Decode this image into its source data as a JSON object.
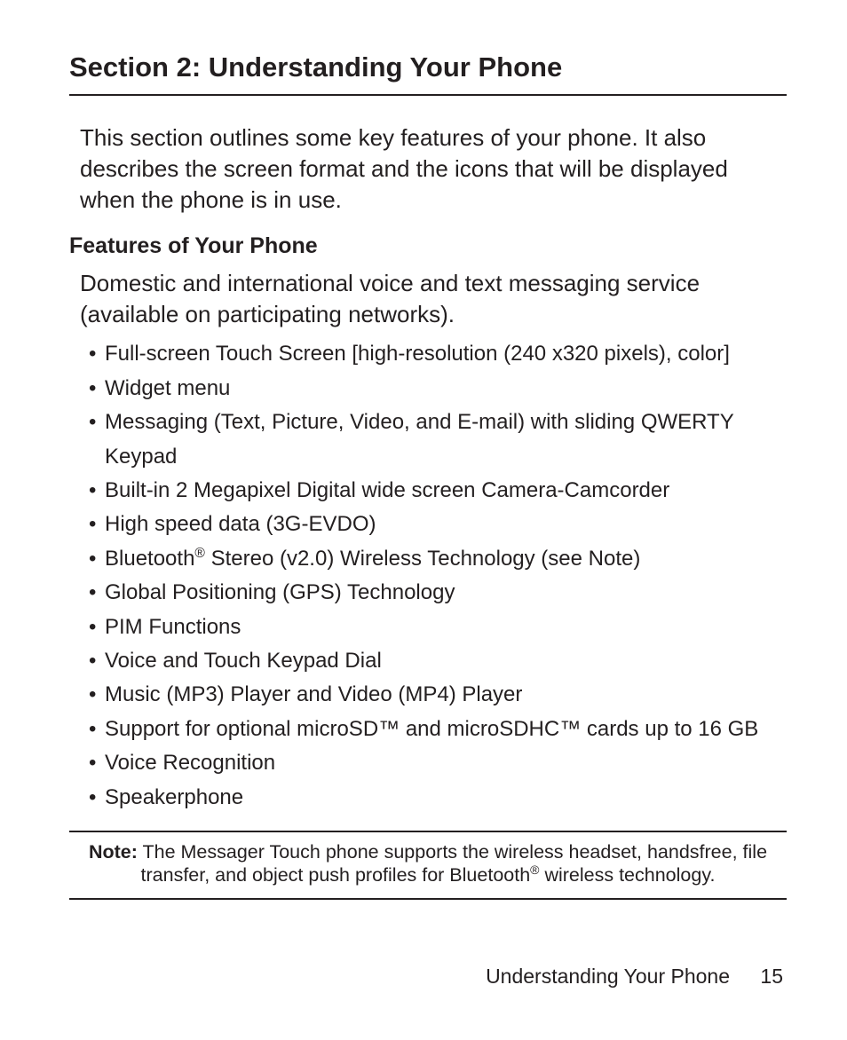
{
  "section_title": "Section 2: Understanding Your Phone",
  "intro": "This section outlines some key features of your phone. It also describes the screen format and the icons that will be displayed when the phone is in use.",
  "subheading": "Features of Your Phone",
  "subintro": "Domestic and international voice and text messaging service (available on participating networks).",
  "features": [
    "Full-screen Touch Screen [high-resolution (240 x320 pixels), color]",
    "Widget menu",
    "Messaging (Text, Picture, Video, and E-mail) with sliding QWERTY Keypad",
    "Built-in 2 Megapixel Digital wide screen Camera-Camcorder",
    "High speed data (3G-EVDO)",
    "Bluetooth® Stereo (v2.0) Wireless Technology (see Note)",
    "Global Positioning (GPS) Technology",
    "PIM Functions",
    "Voice and Touch Keypad Dial",
    "Music (MP3) Player and Video (MP4) Player",
    "Support for optional microSD™ and microSDHC™ cards up to 16 GB",
    "Voice Recognition",
    "Speakerphone"
  ],
  "note_label": "Note:",
  "note_text_before": " The Messager Touch phone supports the wireless headset, handsfree, file transfer, and object push profiles for Bluetooth",
  "note_text_after": " wireless technology.",
  "footer_text": "Understanding Your Phone",
  "page_number": "15"
}
